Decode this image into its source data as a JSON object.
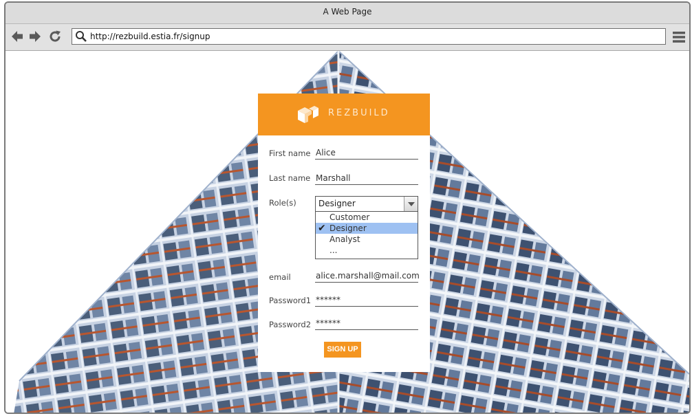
{
  "window": {
    "title": "A Web Page"
  },
  "toolbar": {
    "back_icon": "back-arrow-icon",
    "forward_icon": "forward-arrow-icon",
    "reload_icon": "reload-icon",
    "search_icon": "search-icon",
    "url": "http://rezbuild.estia.fr/signup",
    "menu_icon": "hamburger-menu-icon"
  },
  "brand": {
    "name": "REZBUILD",
    "color": "#f49520"
  },
  "form": {
    "first_name": {
      "label": "First name",
      "value": "Alice"
    },
    "last_name": {
      "label": "Last name",
      "value": "Marshall"
    },
    "roles": {
      "label": "Role(s)",
      "selected": "Designer",
      "options": [
        {
          "label": "Customer",
          "checked": false
        },
        {
          "label": "Designer",
          "checked": true
        },
        {
          "label": "Analyst",
          "checked": false
        },
        {
          "label": "...",
          "checked": false
        }
      ]
    },
    "email": {
      "label": "email",
      "value": "alice.marshall@mail.com"
    },
    "password1": {
      "label": "Password1",
      "value": "******"
    },
    "password2": {
      "label": "Password2",
      "value": "******"
    },
    "submit_label": "SIGN UP"
  }
}
